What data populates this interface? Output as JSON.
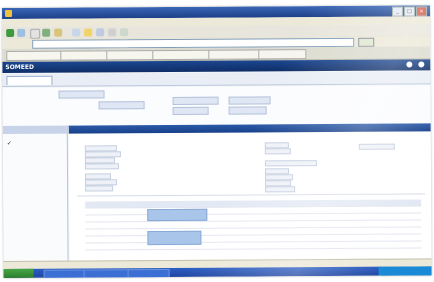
{
  "window": {
    "title": ""
  },
  "menubar": {
    "items": []
  },
  "address": {
    "label": "",
    "value": "",
    "go": ""
  },
  "links": [],
  "app": {
    "brand": "SOMEED"
  },
  "navtabs": [
    {
      "label": ""
    },
    {
      "label": ""
    },
    {
      "label": ""
    },
    {
      "label": ""
    },
    {
      "label": ""
    }
  ],
  "leftpanel": {
    "header": "",
    "item": "✓"
  },
  "main": {
    "header": ""
  },
  "status": {
    "text": ""
  },
  "taskbar": {
    "start": "",
    "items": [],
    "clock": ""
  },
  "colors": {
    "brand": "#1b4690",
    "accent": "#2b5aa8",
    "selection": "#a9c6ea"
  }
}
